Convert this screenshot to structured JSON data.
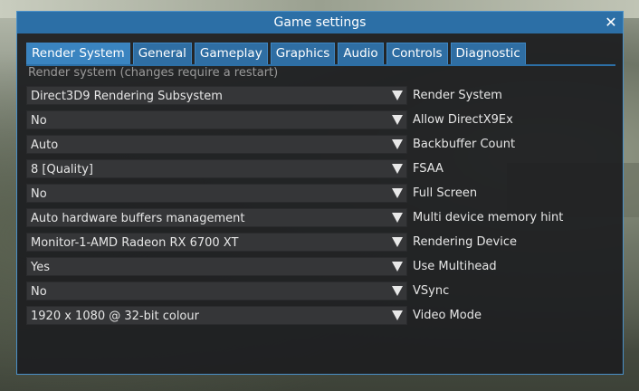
{
  "window": {
    "title": "Game settings",
    "close_symbol": "✕"
  },
  "tabs": [
    {
      "label": "Render System",
      "active": true
    },
    {
      "label": "General",
      "active": false
    },
    {
      "label": "Gameplay",
      "active": false
    },
    {
      "label": "Graphics",
      "active": false
    },
    {
      "label": "Audio",
      "active": false
    },
    {
      "label": "Controls",
      "active": false
    },
    {
      "label": "Diagnostic",
      "active": false
    }
  ],
  "section": {
    "title": "Render system (changes require a restart)"
  },
  "settings": [
    {
      "value": "Direct3D9 Rendering Subsystem",
      "label": "Render System"
    },
    {
      "value": "No",
      "label": "Allow DirectX9Ex"
    },
    {
      "value": "Auto",
      "label": "Backbuffer Count"
    },
    {
      "value": "8 [Quality]",
      "label": "FSAA"
    },
    {
      "value": "No",
      "label": "Full Screen"
    },
    {
      "value": "Auto hardware buffers management",
      "label": "Multi device memory hint"
    },
    {
      "value": "Monitor-1-AMD Radeon RX 6700 XT",
      "label": "Rendering Device"
    },
    {
      "value": "Yes",
      "label": "Use Multihead"
    },
    {
      "value": "No",
      "label": "VSync"
    },
    {
      "value": "1920 x 1080 @ 32-bit colour",
      "label": "Video Mode"
    }
  ],
  "colors": {
    "accent": "#2c6fa6",
    "panel_bg": "#1e1f21",
    "combo_bg": "#353638",
    "text": "#e6e6e6",
    "muted_text": "#9a9a9a"
  }
}
